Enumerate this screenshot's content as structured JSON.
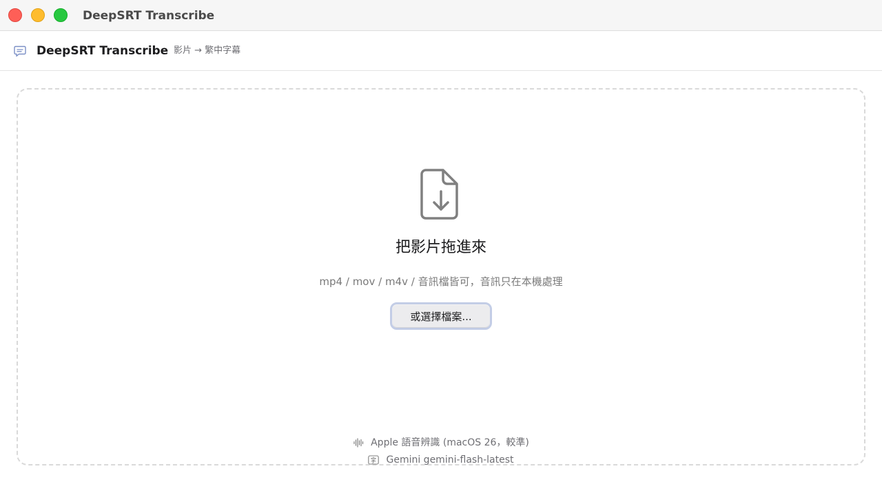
{
  "window": {
    "title": "DeepSRT Transcribe",
    "controls": [
      "close",
      "minimize",
      "zoom"
    ]
  },
  "header": {
    "icon": "speech-bubble-icon",
    "app_name": "DeepSRT Transcribe",
    "subtitle": "影片 → 繁中字幕"
  },
  "dropzone": {
    "icon": "document-download-icon",
    "title": "把影片拖進來",
    "hint": "mp4 / mov / m4v / 音訊檔皆可，音訊只在本機處理",
    "choose_button_label": "或選擇檔案..."
  },
  "engines": {
    "speech": {
      "icon": "waveform-icon",
      "label": "Apple 語音辨識 (macOS 26，較準)"
    },
    "translation": {
      "icon": "character-icon",
      "label": "Gemini gemini-flash-latest"
    }
  },
  "colors": {
    "close": "#fe5f57",
    "minimize": "#febc2e",
    "zoom": "#28c840",
    "focus_ring": "#c3cde6",
    "dashed_border": "#d9d9d9",
    "icon_gray": "#808080"
  }
}
